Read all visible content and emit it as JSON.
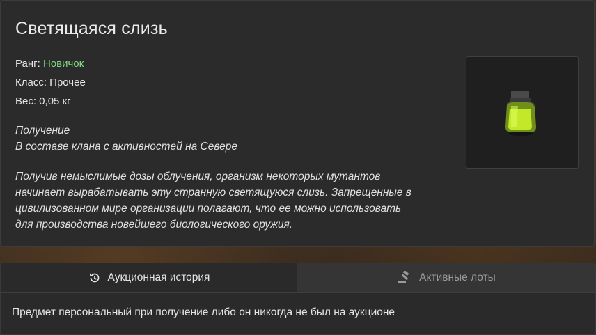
{
  "item": {
    "title": "Светящаяся слизь",
    "rank_label": "Ранг:",
    "rank_value": "Новичок",
    "class_line": "Класс: Прочее",
    "weight_line": "Вес: 0,05 кг",
    "obtain_heading": "Получение",
    "obtain_text": "В составе клана с активностей на Севере",
    "description_lines": [
      "Получив немыслимые дозы облучения, организм некоторых мутантов",
      "начинает вырабатывать эту странную светящуюся слизь. Запрещенные в",
      "цивилизованном мире организации полагают, что ее можно использовать",
      "для производства новейшего биологического оружия."
    ],
    "image_icon": "glowing-slime-jar-icon"
  },
  "tabs": {
    "history_label": "Аукционная история",
    "history_icon": "history-clock-icon",
    "lots_label": "Активные лоты",
    "lots_icon": "gavel-icon"
  },
  "auction": {
    "message": "Предмет персональный при получение либо он никогда не был на аукционе"
  },
  "colors": {
    "rank_novice": "#7fdc7f",
    "slime_green": "#b8e020"
  }
}
